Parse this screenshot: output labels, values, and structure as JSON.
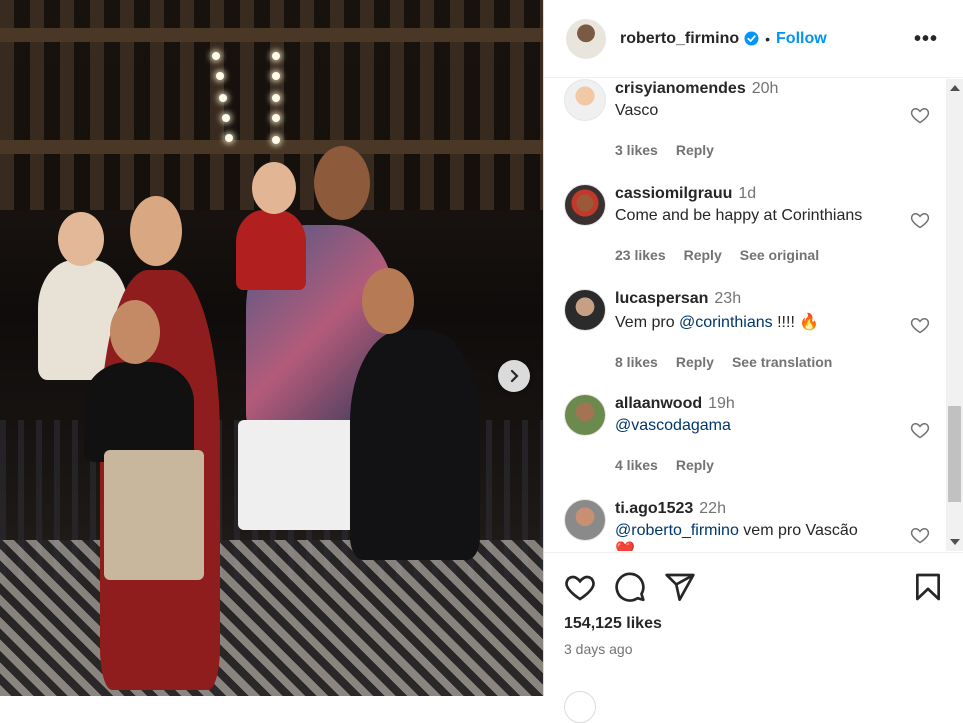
{
  "post": {
    "author": "roberto_firmino",
    "follow_label": "Follow",
    "separator": "•",
    "more_label": "•••",
    "likes": "154,125 likes",
    "time_ago": "3 days ago"
  },
  "comments": [
    {
      "user": "crisyianomendes",
      "time": "20h",
      "text": "Vasco",
      "likes": "3 likes",
      "reply": "Reply",
      "extra": ""
    },
    {
      "user": "cassiomilgrauu",
      "time": "1d",
      "text": "Come and be happy at Corinthians",
      "likes": "23 likes",
      "reply": "Reply",
      "extra": "See original"
    },
    {
      "user": "lucaspersan",
      "time": "23h",
      "text_prefix": "Vem pro ",
      "mention": "@corinthians",
      "text_suffix": " !!!! 🔥",
      "likes": "8 likes",
      "reply": "Reply",
      "extra": "See translation"
    },
    {
      "user": "allaanwood",
      "time": "19h",
      "mention": "@vascodagama",
      "likes": "4 likes",
      "reply": "Reply",
      "extra": ""
    },
    {
      "user": "ti.ago1523",
      "time": "22h",
      "mention": "@roberto_firmino",
      "text_suffix": " vem pro Vascão",
      "second_line": "❤️"
    }
  ],
  "colors": {
    "accent": "#0095f6",
    "text": "#262626",
    "muted": "#737373",
    "verified": "#0095f6"
  },
  "icons": [
    "verified-badge-icon",
    "more-options-icon",
    "heart-icon",
    "comment-icon",
    "share-icon",
    "bookmark-icon",
    "chevron-right-icon"
  ]
}
